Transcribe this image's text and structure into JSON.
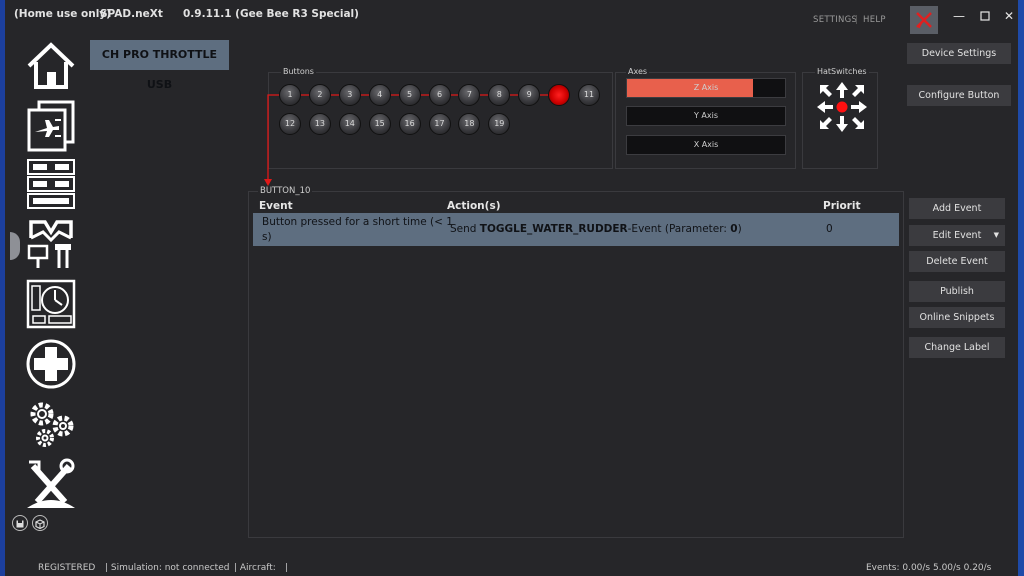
{
  "app": {
    "mode": "(Home use only)",
    "name": "SPAD.neXt",
    "version": "0.9.11.1 (Gee Bee R3 Special)",
    "settings_link": "SETTINGS",
    "separator": "|",
    "help_link": "HELP"
  },
  "device": {
    "tab_label": "CH PRO THROTTLE USB"
  },
  "buttons_group": {
    "label": "Buttons",
    "row1": [
      "1",
      "2",
      "3",
      "4",
      "5",
      "6",
      "7",
      "8",
      "9",
      "10",
      "11"
    ],
    "row2": [
      "12",
      "13",
      "14",
      "15",
      "16",
      "17",
      "18",
      "19"
    ],
    "active": "10"
  },
  "axes_group": {
    "label": "Axes",
    "axes": [
      {
        "label": "Z Axis",
        "fill_fraction": 0.8
      },
      {
        "label": "Y Axis",
        "fill_fraction": 0.0
      },
      {
        "label": "X Axis",
        "fill_fraction": 0.0
      }
    ]
  },
  "hat_group": {
    "label": "HatSwitches"
  },
  "right_buttons": {
    "device_settings": "Device Settings",
    "configure_button": "Configure Button",
    "add_event": "Add Event",
    "edit_event": "Edit Event",
    "delete_event": "Delete Event",
    "publish": "Publish",
    "online_snippets": "Online Snippets",
    "change_label": "Change Label"
  },
  "events": {
    "group_label": "BUTTON_10",
    "headers": {
      "event": "Event",
      "actions": "Action(s)",
      "priority": "Priority"
    },
    "rows": [
      {
        "event_line1": "Button pressed for a short time (< 1",
        "event_line2": "s)",
        "action_prefix": "Send ",
        "action_bold": "TOGGLE_WATER_RUDDER",
        "action_mid": "-Event (Parameter: ",
        "action_param": "0",
        "action_suffix": ")",
        "priority": "0"
      }
    ]
  },
  "status_bar": {
    "registered": "REGISTERED",
    "simulation": "| Simulation: not connected",
    "aircraft": "| Aircraft:",
    "aircraft_end": "|",
    "events_rate": "Events: 0.00/s 5.00/s 0.20/s"
  },
  "colors": {
    "accent": "#5e6e80",
    "active": "#ff0000",
    "axis_fill": "#e8604c"
  }
}
